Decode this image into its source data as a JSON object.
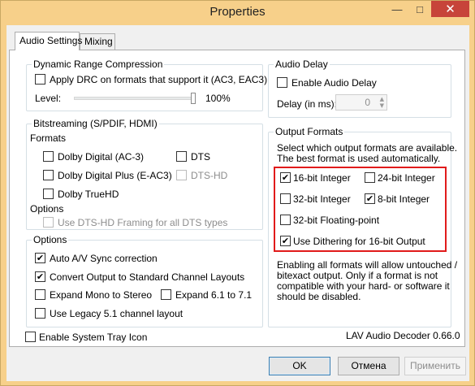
{
  "window": {
    "title": "Properties",
    "close_glyph": "✕",
    "min_glyph": "—",
    "max_glyph": "□"
  },
  "tabs": [
    {
      "label": "Audio Settings"
    },
    {
      "label": "Mixing"
    }
  ],
  "drc": {
    "title": "Dynamic Range Compression",
    "apply_label": "Apply DRC on formats that support it (AC3, EAC3)",
    "apply_checked": false,
    "level_label": "Level:",
    "level_value": "100%",
    "level_fraction": 1.0
  },
  "bitstreaming": {
    "title": "Bitstreaming (S/PDIF, HDMI)",
    "formats_label": "Formats",
    "formats": [
      {
        "label": "Dolby Digital (AC-3)",
        "checked": false,
        "enabled": true
      },
      {
        "label": "DTS",
        "checked": false,
        "enabled": true
      },
      {
        "label": "Dolby Digital Plus (E-AC3)",
        "checked": false,
        "enabled": true
      },
      {
        "label": "DTS-HD",
        "checked": false,
        "enabled": false
      },
      {
        "label": "Dolby TrueHD",
        "checked": false,
        "enabled": true
      }
    ],
    "options_label": "Options",
    "dtshd_framing_label": "Use DTS-HD Framing for all DTS types",
    "dtshd_framing_enabled": false
  },
  "options": {
    "title": "Options",
    "items": [
      {
        "label": "Auto A/V Sync correction",
        "checked": true
      },
      {
        "label": "Convert Output to Standard Channel Layouts",
        "checked": true
      },
      {
        "label": "Expand Mono to Stereo",
        "checked": false
      },
      {
        "label": "Expand 6.1 to 7.1",
        "checked": false
      },
      {
        "label": "Use Legacy 5.1 channel layout",
        "checked": false
      }
    ]
  },
  "system_tray": {
    "label": "Enable System Tray Icon",
    "checked": false
  },
  "audio_delay": {
    "title": "Audio Delay",
    "enable_label": "Enable Audio Delay",
    "enable_checked": false,
    "delay_label": "Delay (in ms):",
    "delay_value": "0"
  },
  "output_formats": {
    "title": "Output Formats",
    "description_line1": "Select which output formats are available.",
    "description_line2": "The best format is used automatically.",
    "items": [
      {
        "label": "16-bit Integer",
        "checked": true
      },
      {
        "label": "24-bit Integer",
        "checked": false
      },
      {
        "label": "32-bit Integer",
        "checked": false
      },
      {
        "label": "8-bit Integer",
        "checked": true
      },
      {
        "label": "32-bit Floating-point",
        "checked": false
      },
      {
        "label": "Use Dithering for 16-bit Output",
        "checked": true
      }
    ],
    "note_lines": [
      "Enabling all formats will allow untouched /",
      "bitexact output. Only if a format is not",
      "compatible with your hard- or software it",
      "should be disabled."
    ]
  },
  "version": "LAV Audio Decoder 0.66.0",
  "buttons": {
    "ok": "OK",
    "cancel": "Отмена",
    "apply": "Применить"
  },
  "colors": {
    "titlebar": "#f7d08a",
    "close": "#c7443a",
    "highlight": "#e11b1b"
  }
}
